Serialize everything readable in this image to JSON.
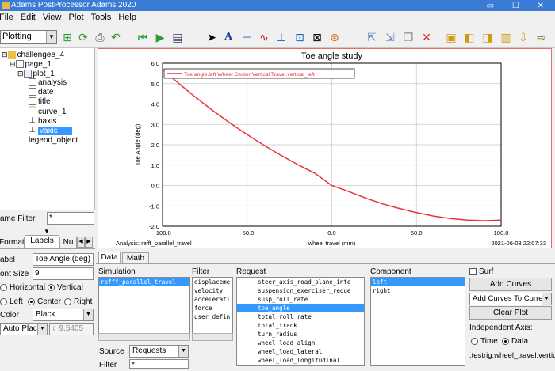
{
  "window": {
    "title": "Adams PostProcessor Adams 2020",
    "controls": "▭ ☐ ✕"
  },
  "menu": [
    "File",
    "Edit",
    "View",
    "Plot",
    "Tools",
    "Help"
  ],
  "toolbar": {
    "mode_select": "Plotting"
  },
  "tree": {
    "items": [
      {
        "label": "challengee_4"
      },
      {
        "label": "page_1"
      },
      {
        "label": "plot_1"
      },
      {
        "label": "analysis"
      },
      {
        "label": "date"
      },
      {
        "label": "title"
      },
      {
        "label": "curve_1"
      },
      {
        "label": "haxis"
      },
      {
        "label": "vaxis"
      },
      {
        "label": "legend_object"
      }
    ]
  },
  "left": {
    "name_filter_label": "ame Filter",
    "name_filter_value": "*",
    "tabs": [
      "Format",
      "Labels",
      "Nu"
    ],
    "label_label": "abel",
    "label_value": "Toe Angle (deg)",
    "font_size_label": "ont Size",
    "font_size_value": "9",
    "orient_h": "Horizontal",
    "orient_v": "Vertical",
    "align_left": "Left",
    "align_center": "Center",
    "align_right": "Right",
    "color_label": "Color",
    "color_value": "Black",
    "place_value": "Auto Place",
    "place_number": "9.5405"
  },
  "plot_footer": {
    "analysis": "Analysis:  refff_parallel_travel",
    "timestamp": "2021-06-08 22:07:33"
  },
  "bottom": {
    "tabs": [
      "Data",
      "Math"
    ],
    "simulation_label": "Simulation",
    "simulation_items": [
      "refff_parallel_travel"
    ],
    "filter_label": "Filter",
    "filter_items": [
      "displaceme",
      "velocity",
      "accelerati",
      "force",
      "user defin"
    ],
    "request_label": "Request",
    "request_items": [
      "steer_axis_road_plane_inte",
      "suspension_exerciser_reque",
      "susp_roll_rate",
      "toe_angle",
      "total_roll_rate",
      "total_track",
      "turn_radius",
      "wheel_load_align",
      "wheel_load_lateral",
      "wheel_load_longitudinal"
    ],
    "request_selected": 3,
    "component_label": "Component",
    "component_items": [
      "left",
      "right"
    ],
    "surf_label": "Surf",
    "add_curves": "Add Curves",
    "add_curves_to": "Add Curves To Current",
    "clear_plot": "Clear Plot",
    "indep_axis_label": "Independent Axis:",
    "time_label": "Time",
    "data_label": "Data",
    "indep_value": ".testrig.wheel_travel.vertica",
    "source_label": "Source",
    "source_value": "Requests",
    "filter2_label": "Filter",
    "filter2_value": "*"
  },
  "chart_data": {
    "type": "line",
    "title": "Toe angle study",
    "xlabel": "wheel travel (mm)",
    "ylabel": "Toe Angle (deg)",
    "xlim": [
      -100.0,
      100.0
    ],
    "ylim": [
      -2.0,
      6.0
    ],
    "xticks": [
      -100.0,
      -50.0,
      0.0,
      50.0,
      100.0
    ],
    "yticks": [
      -2.0,
      -1.0,
      0.0,
      1.0,
      2.0,
      3.0,
      4.0,
      5.0,
      6.0
    ],
    "grid": true,
    "legend_position": "top-left",
    "series": [
      {
        "name": "Toe angle.left Wheel Center Vertical Travel.vertical_left",
        "color": "#e8323c",
        "x": [
          -100,
          -90,
          -80,
          -70,
          -60,
          -50,
          -40,
          -30,
          -20,
          -10,
          0,
          10,
          20,
          30,
          40,
          50,
          60,
          70,
          80,
          90,
          100
        ],
        "y": [
          5.7,
          4.98,
          4.3,
          3.66,
          3.06,
          2.5,
          1.97,
          1.48,
          1.02,
          0.6,
          0.0,
          -0.3,
          -0.62,
          -0.9,
          -1.13,
          -1.33,
          -1.5,
          -1.62,
          -1.7,
          -1.73,
          -1.7
        ]
      }
    ]
  }
}
